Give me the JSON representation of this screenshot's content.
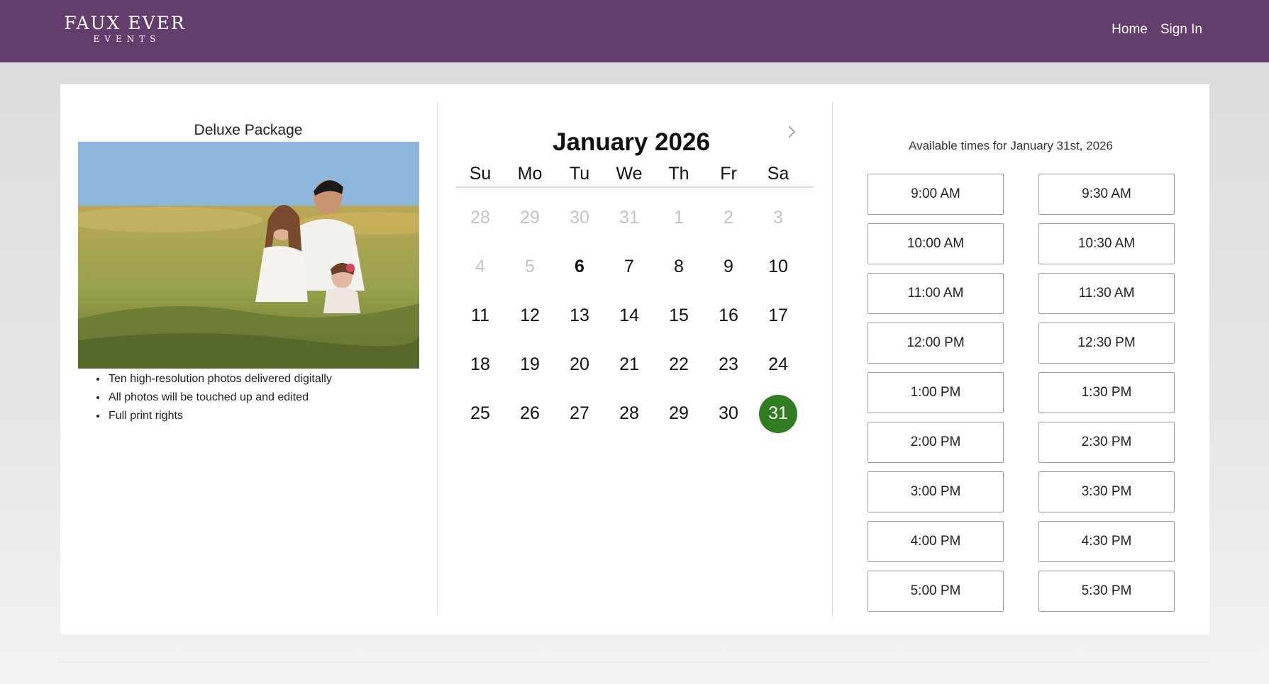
{
  "header": {
    "brand_line1": "FAUX EVER",
    "brand_line2": "EVENTS",
    "nav": {
      "home": "Home",
      "sign_in": "Sign In"
    },
    "color": "#633d6b"
  },
  "package": {
    "title": "Deluxe Package",
    "features": [
      "Ten high-resolution photos delivered digitally",
      "All photos will be touched up and edited",
      "Full print rights"
    ]
  },
  "calendar": {
    "month_label": "January 2026",
    "next_icon": "chevron-right-icon",
    "weekdays": [
      "Su",
      "Mo",
      "Tu",
      "We",
      "Th",
      "Fr",
      "Sa"
    ],
    "weeks": [
      [
        {
          "d": "28",
          "state": "muted"
        },
        {
          "d": "29",
          "state": "muted"
        },
        {
          "d": "30",
          "state": "muted"
        },
        {
          "d": "31",
          "state": "muted"
        },
        {
          "d": "1",
          "state": "muted"
        },
        {
          "d": "2",
          "state": "muted"
        },
        {
          "d": "3",
          "state": "muted"
        }
      ],
      [
        {
          "d": "4",
          "state": "muted"
        },
        {
          "d": "5",
          "state": "muted"
        },
        {
          "d": "6",
          "state": "today"
        },
        {
          "d": "7",
          "state": "normal"
        },
        {
          "d": "8",
          "state": "normal"
        },
        {
          "d": "9",
          "state": "normal"
        },
        {
          "d": "10",
          "state": "normal"
        }
      ],
      [
        {
          "d": "11",
          "state": "normal"
        },
        {
          "d": "12",
          "state": "normal"
        },
        {
          "d": "13",
          "state": "normal"
        },
        {
          "d": "14",
          "state": "normal"
        },
        {
          "d": "15",
          "state": "normal"
        },
        {
          "d": "16",
          "state": "normal"
        },
        {
          "d": "17",
          "state": "normal"
        }
      ],
      [
        {
          "d": "18",
          "state": "normal"
        },
        {
          "d": "19",
          "state": "normal"
        },
        {
          "d": "20",
          "state": "normal"
        },
        {
          "d": "21",
          "state": "normal"
        },
        {
          "d": "22",
          "state": "normal"
        },
        {
          "d": "23",
          "state": "normal"
        },
        {
          "d": "24",
          "state": "normal"
        }
      ],
      [
        {
          "d": "25",
          "state": "normal"
        },
        {
          "d": "26",
          "state": "normal"
        },
        {
          "d": "27",
          "state": "normal"
        },
        {
          "d": "28",
          "state": "normal"
        },
        {
          "d": "29",
          "state": "normal"
        },
        {
          "d": "30",
          "state": "normal"
        },
        {
          "d": "31",
          "state": "selected"
        }
      ]
    ],
    "selected_color": "#2f7d20"
  },
  "times": {
    "title": "Available times for January 31st, 2026",
    "slots": [
      "9:00 AM",
      "9:30 AM",
      "10:00 AM",
      "10:30 AM",
      "11:00 AM",
      "11:30 AM",
      "12:00 PM",
      "12:30 PM",
      "1:00 PM",
      "1:30 PM",
      "2:00 PM",
      "2:30 PM",
      "3:00 PM",
      "3:30 PM",
      "4:00 PM",
      "4:30 PM",
      "5:00 PM",
      "5:30 PM"
    ]
  }
}
